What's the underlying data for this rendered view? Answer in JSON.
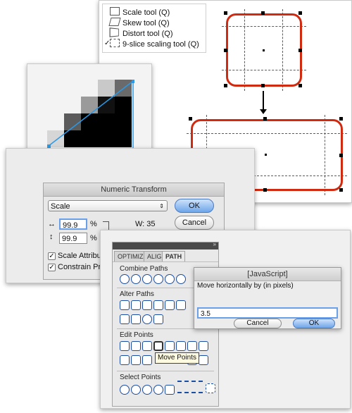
{
  "tool_menu": {
    "items": [
      {
        "label": "Scale tool (Q)",
        "icon": "scale-tool-icon",
        "checked": false
      },
      {
        "label": "Skew tool (Q)",
        "icon": "skew-tool-icon",
        "checked": false
      },
      {
        "label": "Distort tool (Q)",
        "icon": "distort-tool-icon",
        "checked": false
      },
      {
        "label": "9-slice scaling tool (Q)",
        "icon": "nine-slice-tool-icon",
        "checked": true
      }
    ],
    "checkmark": "✓"
  },
  "numeric_transform": {
    "title": "Numeric Transform",
    "mode_select": "Scale",
    "ok_label": "OK",
    "cancel_label": "Cancel",
    "width_value": "99.9",
    "height_value": "99.9",
    "percent": "%",
    "width_readout": "W: 35",
    "scale_attributes_label": "Scale Attribute",
    "constrain_label": "Constrain Prop"
  },
  "panel": {
    "tabs": [
      "OPTIMIZE",
      "ALIGN",
      "PATH"
    ],
    "active_tab": "PATH",
    "sections": {
      "combine": "Combine Paths",
      "alter": "Alter Paths",
      "edit": "Edit Points",
      "select": "Select Points"
    },
    "tooltip": "Move Points"
  },
  "js_dialog": {
    "title": "[JavaScript]",
    "prompt": "Move horizontally by (in pixels)",
    "input_value": "3.5",
    "cancel_label": "Cancel",
    "ok_label": "OK"
  },
  "colors": {
    "slice_border": "#d02a10",
    "guide": "#4a4ae0",
    "pixel_line": "#2a9ae8",
    "accent_button": "#6ea6ea"
  }
}
